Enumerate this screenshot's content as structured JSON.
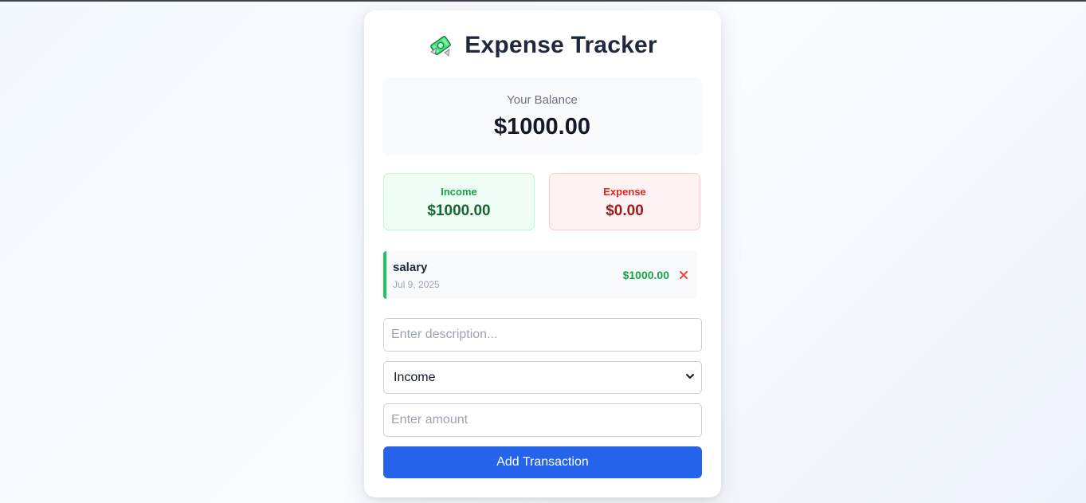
{
  "app": {
    "title": "Expense Tracker",
    "icon": "money-with-wings-icon"
  },
  "balance": {
    "label": "Your Balance",
    "value": "$1000.00"
  },
  "summary": {
    "income": {
      "label": "Income",
      "value": "$1000.00",
      "color": "#16a34a"
    },
    "expense": {
      "label": "Expense",
      "value": "$0.00",
      "color": "#dc2626"
    }
  },
  "transactions": [
    {
      "description": "salary",
      "date": "Jul 9, 2025",
      "amount": "$1000.00",
      "type": "income",
      "delete_icon": "close-icon"
    }
  ],
  "form": {
    "description_placeholder": "Enter description...",
    "type_selected": "Income",
    "amount_placeholder": "Enter amount",
    "submit_label": "Add Transaction"
  },
  "colors": {
    "accent": "#2563eb",
    "income": "#22c55e",
    "expense": "#ef4444"
  }
}
